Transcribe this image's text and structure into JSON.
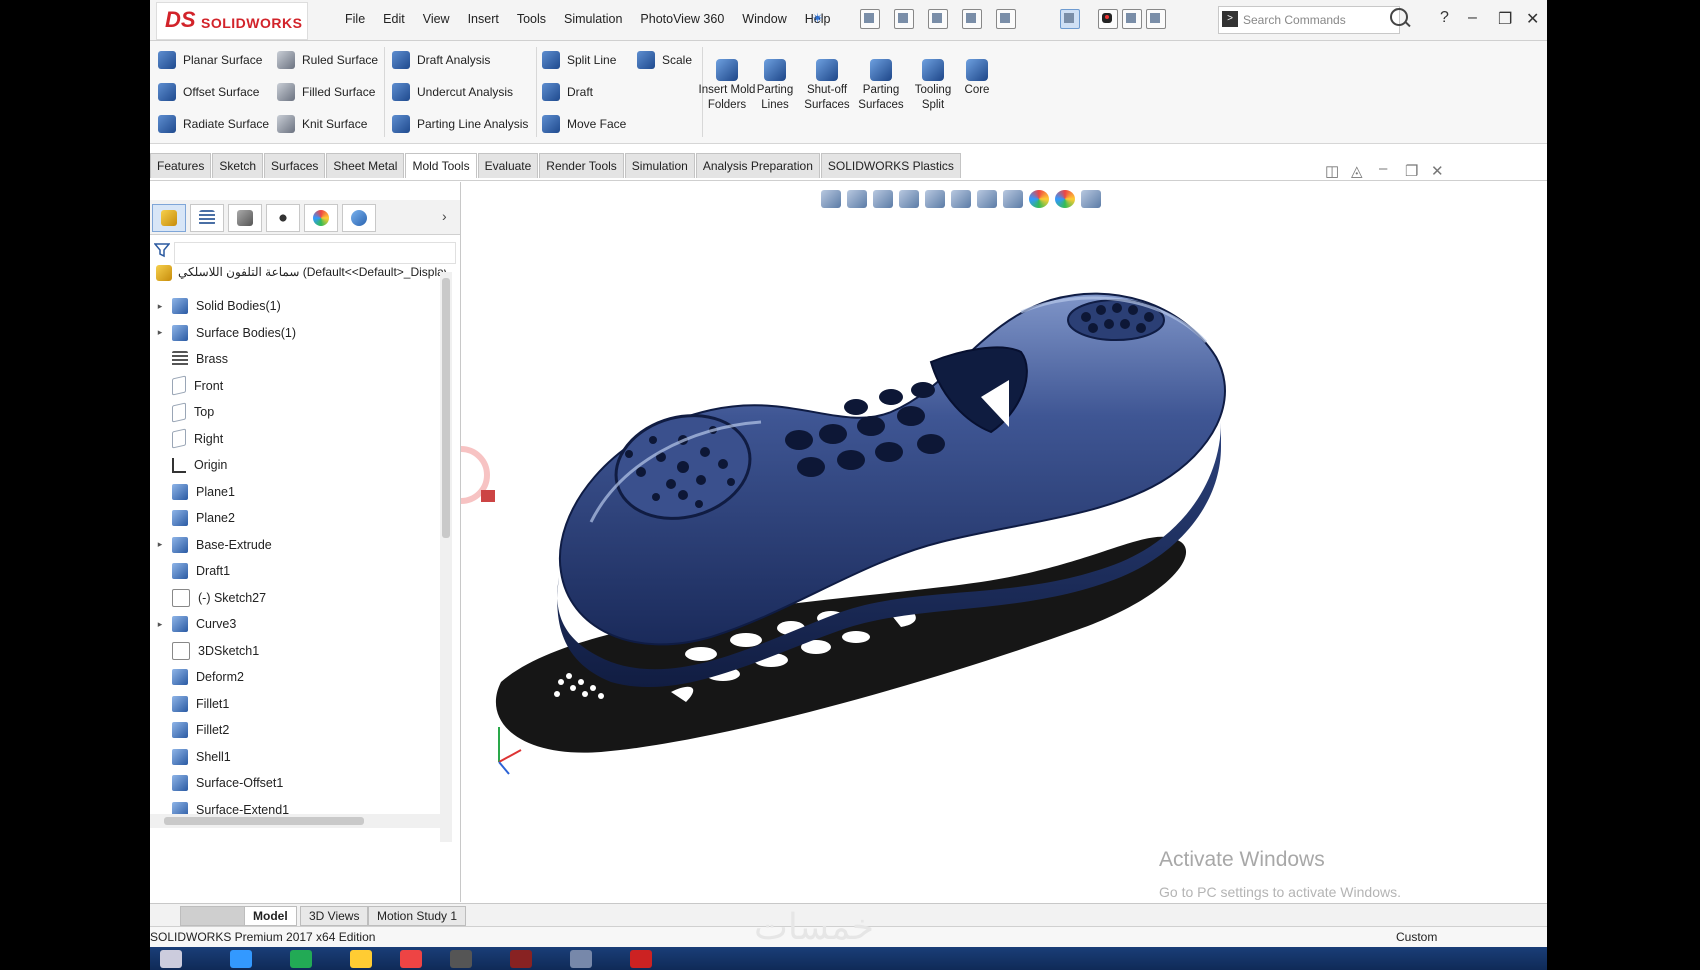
{
  "app": {
    "logo_ds": "DS",
    "logo_name": "SOLIDWORKS",
    "edition": "SOLIDWORKS Premium 2017 x64 Edition",
    "units": "Custom"
  },
  "menu": [
    "File",
    "Edit",
    "View",
    "Insert",
    "Tools",
    "Simulation",
    "PhotoView 360",
    "Window",
    "Help"
  ],
  "search": {
    "placeholder": "Search Commands"
  },
  "ribbon": {
    "col1": [
      "Planar Surface",
      "Offset Surface",
      "Radiate Surface"
    ],
    "col2": [
      "Ruled Surface",
      "Filled Surface",
      "Knit Surface"
    ],
    "col3": [
      "Draft Analysis",
      "Undercut Analysis",
      "Parting Line Analysis"
    ],
    "col4": [
      "Split Line",
      "Draft",
      "Move Face"
    ],
    "col5": [
      "Scale"
    ],
    "big": [
      {
        "label": "Insert Mold Folders"
      },
      {
        "label": "Parting Lines"
      },
      {
        "label": "Shut-off Surfaces"
      },
      {
        "label": "Parting Surfaces"
      },
      {
        "label": "Tooling Split"
      },
      {
        "label": "Core"
      }
    ]
  },
  "tabs": [
    "Features",
    "Sketch",
    "Surfaces",
    "Sheet Metal",
    "Mold Tools",
    "Evaluate",
    "Render Tools",
    "Simulation",
    "Analysis Preparation",
    "SOLIDWORKS Plastics"
  ],
  "active_tab": "Mold Tools",
  "feature_tree": {
    "part_name": "سماعة التلفون اللاسلكي",
    "part_config": "(Default<<Default>_Display",
    "nodes": [
      {
        "label": "Solid Bodies(1)",
        "expand": true,
        "icon": "solid-bodies"
      },
      {
        "label": "Surface Bodies(1)",
        "expand": true,
        "icon": "surface-bodies"
      },
      {
        "label": "Brass",
        "expand": false,
        "icon": "material"
      },
      {
        "label": "Front",
        "expand": false,
        "icon": "plane"
      },
      {
        "label": "Top",
        "expand": false,
        "icon": "plane"
      },
      {
        "label": "Right",
        "expand": false,
        "icon": "plane"
      },
      {
        "label": "Origin",
        "expand": false,
        "icon": "origin"
      },
      {
        "label": "Plane1",
        "expand": false,
        "icon": "ref-plane"
      },
      {
        "label": "Plane2",
        "expand": false,
        "icon": "ref-plane"
      },
      {
        "label": "Base-Extrude",
        "expand": true,
        "icon": "extrude"
      },
      {
        "label": "Draft1",
        "expand": false,
        "icon": "draft"
      },
      {
        "label": "(-) Sketch27",
        "expand": false,
        "icon": "sketch"
      },
      {
        "label": "Curve3",
        "expand": true,
        "icon": "curve"
      },
      {
        "label": "3DSketch1",
        "expand": false,
        "icon": "3d-sketch"
      },
      {
        "label": "Deform2",
        "expand": false,
        "icon": "deform"
      },
      {
        "label": "Fillet1",
        "expand": false,
        "icon": "fillet"
      },
      {
        "label": "Fillet2",
        "expand": false,
        "icon": "fillet"
      },
      {
        "label": "Shell1",
        "expand": false,
        "icon": "shell"
      },
      {
        "label": "Surface-Offset1",
        "expand": false,
        "icon": "surface-offset"
      },
      {
        "label": "Surface-Extend1",
        "expand": false,
        "icon": "surface-extend"
      }
    ]
  },
  "bottom_tabs": [
    "Model",
    "3D Views",
    "Motion Study 1"
  ],
  "overlay": {
    "activate_title": "Activate Windows",
    "activate_sub": "Go to PC settings to activate Windows.",
    "watermark": "خمسات"
  },
  "colors": {
    "accent": "#d2232a",
    "model_blue": "#23386e",
    "model_highlight": "#8fa6d6",
    "taskbar": "#12305f"
  }
}
